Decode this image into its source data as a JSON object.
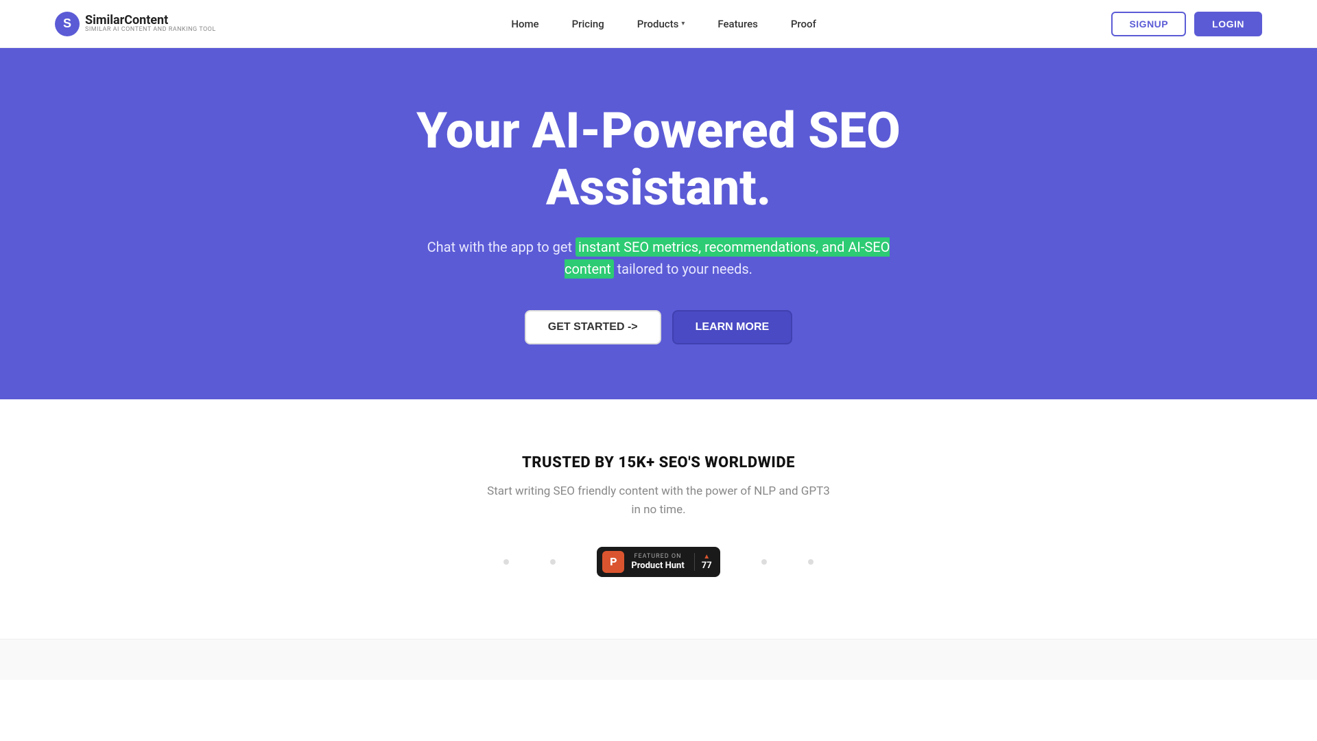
{
  "brand": {
    "name": "SimilarContent",
    "subtitle": "SIMILAR AI CONTENT AND RANKING TOOL",
    "logo_letter": "S"
  },
  "nav": {
    "home": "Home",
    "pricing": "Pricing",
    "products": "Products",
    "features": "Features",
    "proof": "Proof"
  },
  "actions": {
    "signup": "SIGNUP",
    "login": "LOGIN"
  },
  "hero": {
    "title": "Your AI-Powered SEO Assistant.",
    "subtitle_before": "Chat with the app to get ",
    "subtitle_highlight": "instant SEO metrics, recommendations, and AI-SEO content",
    "subtitle_after": " tailored to your needs.",
    "cta_primary": "GET STARTED ->",
    "cta_secondary": "LEARN MORE"
  },
  "trusted": {
    "title": "TRUSTED BY 15K+ SEO'S WORLDWIDE",
    "subtitle_line1": "Start writing SEO friendly content with the power of NLP and GPT3",
    "subtitle_line2": "in no time."
  },
  "product_hunt": {
    "featured_label": "FEATURED ON",
    "name": "Product Hunt",
    "votes": "77"
  },
  "colors": {
    "hero_bg": "#5b5bd6",
    "highlight_bg": "#2dcb73",
    "brand_purple": "#5b5bd6",
    "ph_orange": "#da552f",
    "ph_dark": "#1a1a1a"
  }
}
